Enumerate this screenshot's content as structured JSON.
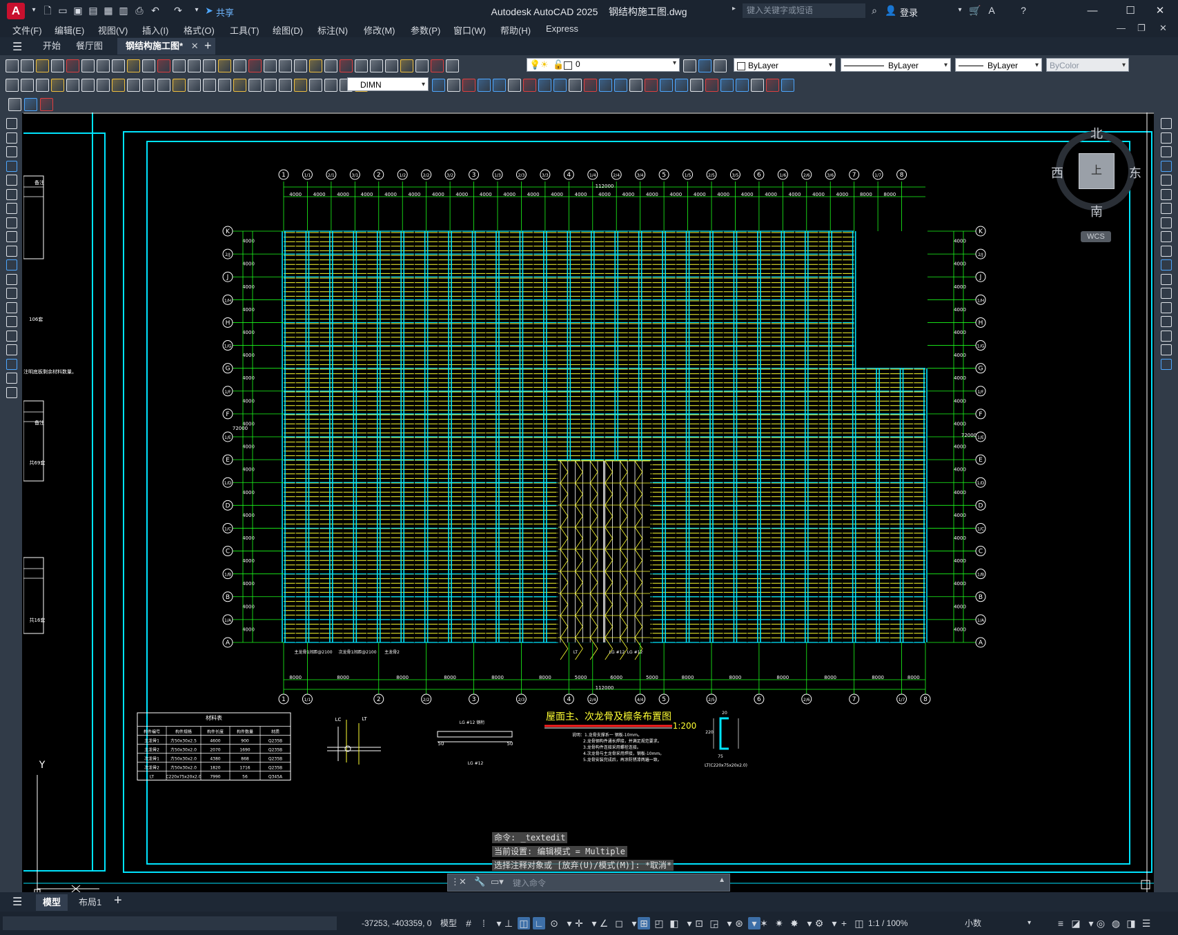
{
  "app": {
    "logo": "A",
    "title": "Autodesk AutoCAD 2025",
    "filename": "钢结构施工图.dwg",
    "share_label": "共享",
    "search_placeholder": "键入关键字或短语",
    "login_label": "登录"
  },
  "menu": [
    "文件(F)",
    "编辑(E)",
    "视图(V)",
    "插入(I)",
    "格式(O)",
    "工具(T)",
    "绘图(D)",
    "标注(N)",
    "修改(M)",
    "参数(P)",
    "窗口(W)",
    "帮助(H)",
    "Express"
  ],
  "tabs": [
    "开始",
    "餐厅图",
    "钢结构施工图*"
  ],
  "toolbar": {
    "layer_value": "0",
    "color_value": "ByLayer",
    "linetype_value": "ByLayer",
    "lineweight_value": "ByLayer",
    "plotstyle_value": "ByColor",
    "dimstyle_value": "DIMN"
  },
  "viewcube": {
    "north": "北",
    "south": "南",
    "east": "东",
    "west": "西",
    "face": "上",
    "wcs": "WCS"
  },
  "drawing": {
    "grid_numbers_top": [
      "1",
      "1/1",
      "2/1",
      "3/1",
      "2",
      "1/2",
      "2/2",
      "3/2",
      "3",
      "1/3",
      "2/3",
      "3/3",
      "4",
      "1/4",
      "2/4",
      "3/4",
      "5",
      "1/5",
      "2/5",
      "3/5",
      "6",
      "1/6",
      "2/6",
      "3/6",
      "7",
      "1/7",
      "8"
    ],
    "grid_numbers_bottom": [
      "1",
      "1/1",
      "2",
      "2/2",
      "3",
      "2/3",
      "4",
      "2/4",
      "4/4",
      "5",
      "2/5",
      "6",
      "2/6",
      "7",
      "1/7",
      "8"
    ],
    "grid_letters": [
      "K",
      "2/J",
      "J",
      "1/H",
      "H",
      "1/G",
      "G",
      "1/F",
      "F",
      "1/E",
      "E",
      "1/D",
      "D",
      "1/C",
      "C",
      "1/B",
      "B",
      "1/A",
      "A"
    ],
    "top_dims": [
      "4000",
      "4000",
      "4000",
      "4000",
      "4000",
      "4000",
      "4000",
      "4000",
      "4000",
      "4000",
      "4000",
      "4000",
      "4000",
      "4000",
      "4000",
      "4000",
      "4000",
      "4000",
      "4000",
      "4000",
      "4000",
      "4000",
      "4000",
      "4000",
      "8000",
      "8000"
    ],
    "total_dim": "112000",
    "bottom_dims": [
      "8000",
      "8000",
      "8000",
      "8000",
      "8000",
      "8000",
      "5000",
      "6000",
      "5000",
      "8000",
      "8000",
      "8000",
      "8000",
      "8000",
      "8000"
    ],
    "side_dim": "4000",
    "side_total": "72000",
    "drawing_title": "屋面主、次龙骨及檩条布置图",
    "scale": "1:200",
    "labels_bottom": [
      "主龙骨1间距@2100",
      "次龙骨1间距@2100",
      "主龙骨2",
      "LT",
      "LG #12",
      "LG #12"
    ],
    "left_notes": [
      "106套",
      "共69套",
      "共16套",
      "备注",
      "备注"
    ],
    "left_note_text": "注明底板剩余材料数量。",
    "notes": [
      "说明：1.龙骨支撑系一 钢板-10mm。",
      "2.龙骨钢构件通长焊接，并满足规范要求。",
      "3.龙骨构件连接采用螺栓连接。",
      "4.次龙骨与主龙骨采用焊接，钢板-10mm。",
      "5.龙骨安装完成后，再涂防锈漆两遍一致。"
    ],
    "table": {
      "title": "材料表",
      "headers": [
        "构件编号",
        "构件规格",
        "构件长度",
        "构件数量",
        "材质"
      ],
      "rows": [
        [
          "主龙骨1",
          "方50x30x2.5",
          "4600",
          "900",
          "Q235B"
        ],
        [
          "主龙骨2",
          "方50x30x2.0",
          "2070",
          "1690",
          "Q235B"
        ],
        [
          "次龙骨1",
          "方50x30x2.0",
          "4380",
          "868",
          "Q235B"
        ],
        [
          "次龙骨2",
          "方50x30x2.0",
          "1820",
          "1716",
          "Q235B"
        ],
        [
          "LT",
          "C220x75x20x2.0",
          "7990",
          "56",
          "Q345A"
        ]
      ]
    },
    "detail_labels": [
      "LC",
      "LT",
      "LG #12",
      "50",
      "50",
      "LT(C220x75x20x2.0)",
      "LG #12 钢桁",
      "75",
      "220",
      "20"
    ],
    "ucs_y": "Y"
  },
  "command": {
    "history": [
      "命令: _textedit",
      "当前设置: 编辑模式 = Multiple",
      "选择注释对象或 [放弃(U)/模式(M)]: *取消*"
    ],
    "input_placeholder": "键入命令"
  },
  "layout_tabs": [
    "模型",
    "布局1"
  ],
  "status": {
    "coords": "-37253, -403359, 0",
    "model_label": "模型",
    "scale": "1:1 / 100%",
    "units": "小数"
  },
  "colors": {
    "cyan": "#00e5ff",
    "yellow": "#ffff33",
    "green": "#1cff1c",
    "white": "#ffffff",
    "red": "#ff2020"
  }
}
